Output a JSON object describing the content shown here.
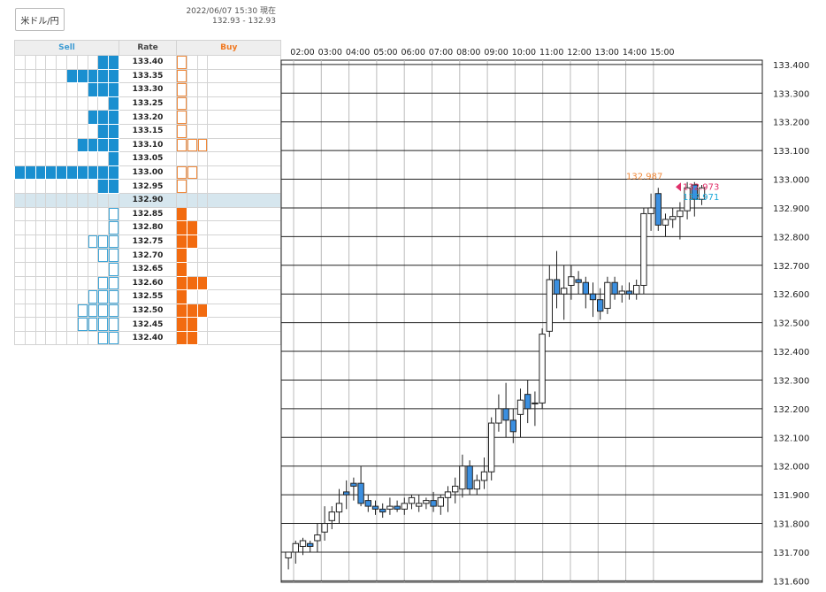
{
  "header": {
    "pair_button": "米ドル/円",
    "timestamp": "2022/06/07 15:30 現在",
    "bid_ask": "132.93 - 132.93"
  },
  "order_book": {
    "headers": {
      "sell": "Sell",
      "rate": "Rate",
      "buy": "Buy"
    },
    "current_rate": "132.90",
    "rows": [
      {
        "rate": "133.40",
        "sell_filled": 2,
        "sell_outline": 0,
        "buy_filled": 0,
        "buy_outline": 1
      },
      {
        "rate": "133.35",
        "sell_filled": 5,
        "sell_outline": 0,
        "buy_filled": 0,
        "buy_outline": 1
      },
      {
        "rate": "133.30",
        "sell_filled": 3,
        "sell_outline": 0,
        "buy_filled": 0,
        "buy_outline": 1
      },
      {
        "rate": "133.25",
        "sell_filled": 1,
        "sell_outline": 0,
        "buy_filled": 0,
        "buy_outline": 1
      },
      {
        "rate": "133.20",
        "sell_filled": 3,
        "sell_outline": 0,
        "buy_filled": 0,
        "buy_outline": 1
      },
      {
        "rate": "133.15",
        "sell_filled": 2,
        "sell_outline": 0,
        "buy_filled": 0,
        "buy_outline": 1
      },
      {
        "rate": "133.10",
        "sell_filled": 4,
        "sell_outline": 0,
        "buy_filled": 0,
        "buy_outline": 3
      },
      {
        "rate": "133.05",
        "sell_filled": 1,
        "sell_outline": 0,
        "buy_filled": 0,
        "buy_outline": 0
      },
      {
        "rate": "133.00",
        "sell_filled": 10,
        "sell_outline": 0,
        "buy_filled": 0,
        "buy_outline": 2
      },
      {
        "rate": "132.95",
        "sell_filled": 2,
        "sell_outline": 0,
        "buy_filled": 0,
        "buy_outline": 1
      },
      {
        "rate": "132.90",
        "sell_filled": 0,
        "sell_outline": 0,
        "buy_filled": 0,
        "buy_outline": 0
      },
      {
        "rate": "132.85",
        "sell_filled": 0,
        "sell_outline": 1,
        "buy_filled": 1,
        "buy_outline": 0
      },
      {
        "rate": "132.80",
        "sell_filled": 0,
        "sell_outline": 1,
        "buy_filled": 2,
        "buy_outline": 0
      },
      {
        "rate": "132.75",
        "sell_filled": 0,
        "sell_outline": 3,
        "buy_filled": 2,
        "buy_outline": 0
      },
      {
        "rate": "132.70",
        "sell_filled": 0,
        "sell_outline": 2,
        "buy_filled": 1,
        "buy_outline": 0
      },
      {
        "rate": "132.65",
        "sell_filled": 0,
        "sell_outline": 1,
        "buy_filled": 1,
        "buy_outline": 0
      },
      {
        "rate": "132.60",
        "sell_filled": 0,
        "sell_outline": 2,
        "buy_filled": 3,
        "buy_outline": 0
      },
      {
        "rate": "132.55",
        "sell_filled": 0,
        "sell_outline": 3,
        "buy_filled": 1,
        "buy_outline": 0
      },
      {
        "rate": "132.50",
        "sell_filled": 0,
        "sell_outline": 4,
        "buy_filled": 3,
        "buy_outline": 0
      },
      {
        "rate": "132.45",
        "sell_filled": 0,
        "sell_outline": 4,
        "buy_filled": 2,
        "buy_outline": 0
      },
      {
        "rate": "132.40",
        "sell_filled": 0,
        "sell_outline": 2,
        "buy_filled": 2,
        "buy_outline": 0
      }
    ]
  },
  "colors": {
    "sell": "#1a8fd0",
    "buy": "#f26b10",
    "bear_candle": "#3b8fe0",
    "high_label": "#f08a3c",
    "ask_marker": "#e0306a",
    "bid_label": "#1aa7d8"
  },
  "chart_data": {
    "type": "candlestick",
    "x_labels": [
      "02:00",
      "03:00",
      "04:00",
      "05:00",
      "06:00",
      "07:00",
      "08:00",
      "09:00",
      "10:00",
      "11:00",
      "12:00",
      "13:00",
      "14:00",
      "15:00"
    ],
    "y_ticks": [
      "133.400",
      "133.300",
      "133.200",
      "133.100",
      "133.000",
      "132.900",
      "132.800",
      "132.700",
      "132.600",
      "132.500",
      "132.400",
      "132.300",
      "132.200",
      "132.100",
      "132.000",
      "131.900",
      "131.800",
      "131.700",
      "131.600"
    ],
    "ylim": [
      131.595,
      133.415
    ],
    "high_label": "132.987",
    "ask_label": "132.973",
    "bid_label": "132.971",
    "candles": [
      [
        131.68,
        131.7,
        131.64,
        131.7
      ],
      [
        131.7,
        131.74,
        131.66,
        131.73
      ],
      [
        131.72,
        131.75,
        131.69,
        131.74
      ],
      [
        131.73,
        131.74,
        131.7,
        131.72
      ],
      [
        131.74,
        131.8,
        131.7,
        131.76
      ],
      [
        131.77,
        131.86,
        131.74,
        131.8
      ],
      [
        131.81,
        131.86,
        131.78,
        131.84
      ],
      [
        131.84,
        131.92,
        131.8,
        131.87
      ],
      [
        131.91,
        131.95,
        131.85,
        131.9
      ],
      [
        131.94,
        131.96,
        131.88,
        131.93
      ],
      [
        131.94,
        132.0,
        131.86,
        131.87
      ],
      [
        131.88,
        131.9,
        131.84,
        131.86
      ],
      [
        131.86,
        131.88,
        131.83,
        131.85
      ],
      [
        131.85,
        131.87,
        131.82,
        131.84
      ],
      [
        131.85,
        131.89,
        131.83,
        131.86
      ],
      [
        131.86,
        131.88,
        131.84,
        131.85
      ],
      [
        131.85,
        131.89,
        131.83,
        131.87
      ],
      [
        131.87,
        131.9,
        131.85,
        131.89
      ],
      [
        131.86,
        131.9,
        131.84,
        131.87
      ],
      [
        131.87,
        131.89,
        131.85,
        131.88
      ],
      [
        131.88,
        131.91,
        131.84,
        131.86
      ],
      [
        131.86,
        131.9,
        131.83,
        131.89
      ],
      [
        131.89,
        131.93,
        131.84,
        131.91
      ],
      [
        131.91,
        131.96,
        131.87,
        131.93
      ],
      [
        131.92,
        132.04,
        131.89,
        132.0
      ],
      [
        132.0,
        132.02,
        131.9,
        131.92
      ],
      [
        131.92,
        131.97,
        131.9,
        131.95
      ],
      [
        131.95,
        132.03,
        131.92,
        131.98
      ],
      [
        131.98,
        132.17,
        131.95,
        132.15
      ],
      [
        132.15,
        132.25,
        132.12,
        132.2
      ],
      [
        132.2,
        132.29,
        132.1,
        132.16
      ],
      [
        132.16,
        132.2,
        132.08,
        132.12
      ],
      [
        132.18,
        132.27,
        132.1,
        132.23
      ],
      [
        132.25,
        132.3,
        132.15,
        132.2
      ],
      [
        132.22,
        132.26,
        132.14,
        132.22
      ],
      [
        132.22,
        132.48,
        132.2,
        132.46
      ],
      [
        132.47,
        132.7,
        132.45,
        132.65
      ],
      [
        132.65,
        132.75,
        132.55,
        132.6
      ],
      [
        132.6,
        132.7,
        132.51,
        132.62
      ],
      [
        132.63,
        132.7,
        132.58,
        132.66
      ],
      [
        132.65,
        132.68,
        132.6,
        132.64
      ],
      [
        132.64,
        132.66,
        132.55,
        132.6
      ],
      [
        132.6,
        132.64,
        132.52,
        132.58
      ],
      [
        132.58,
        132.62,
        132.51,
        132.54
      ],
      [
        132.55,
        132.66,
        132.53,
        132.64
      ],
      [
        132.64,
        132.66,
        132.58,
        132.6
      ],
      [
        132.6,
        132.63,
        132.57,
        132.61
      ],
      [
        132.61,
        132.64,
        132.58,
        132.6
      ],
      [
        132.6,
        132.65,
        132.58,
        132.63
      ],
      [
        132.63,
        132.9,
        132.6,
        132.88
      ],
      [
        132.88,
        132.95,
        132.82,
        132.9
      ],
      [
        132.95,
        132.97,
        132.82,
        132.84
      ],
      [
        132.84,
        132.88,
        132.8,
        132.86
      ],
      [
        132.86,
        132.9,
        132.83,
        132.87
      ],
      [
        132.87,
        132.92,
        132.79,
        132.89
      ],
      [
        132.89,
        132.99,
        132.86,
        132.97
      ],
      [
        132.98,
        132.99,
        132.87,
        132.93
      ],
      [
        132.93,
        132.98,
        132.91,
        132.97
      ]
    ]
  }
}
